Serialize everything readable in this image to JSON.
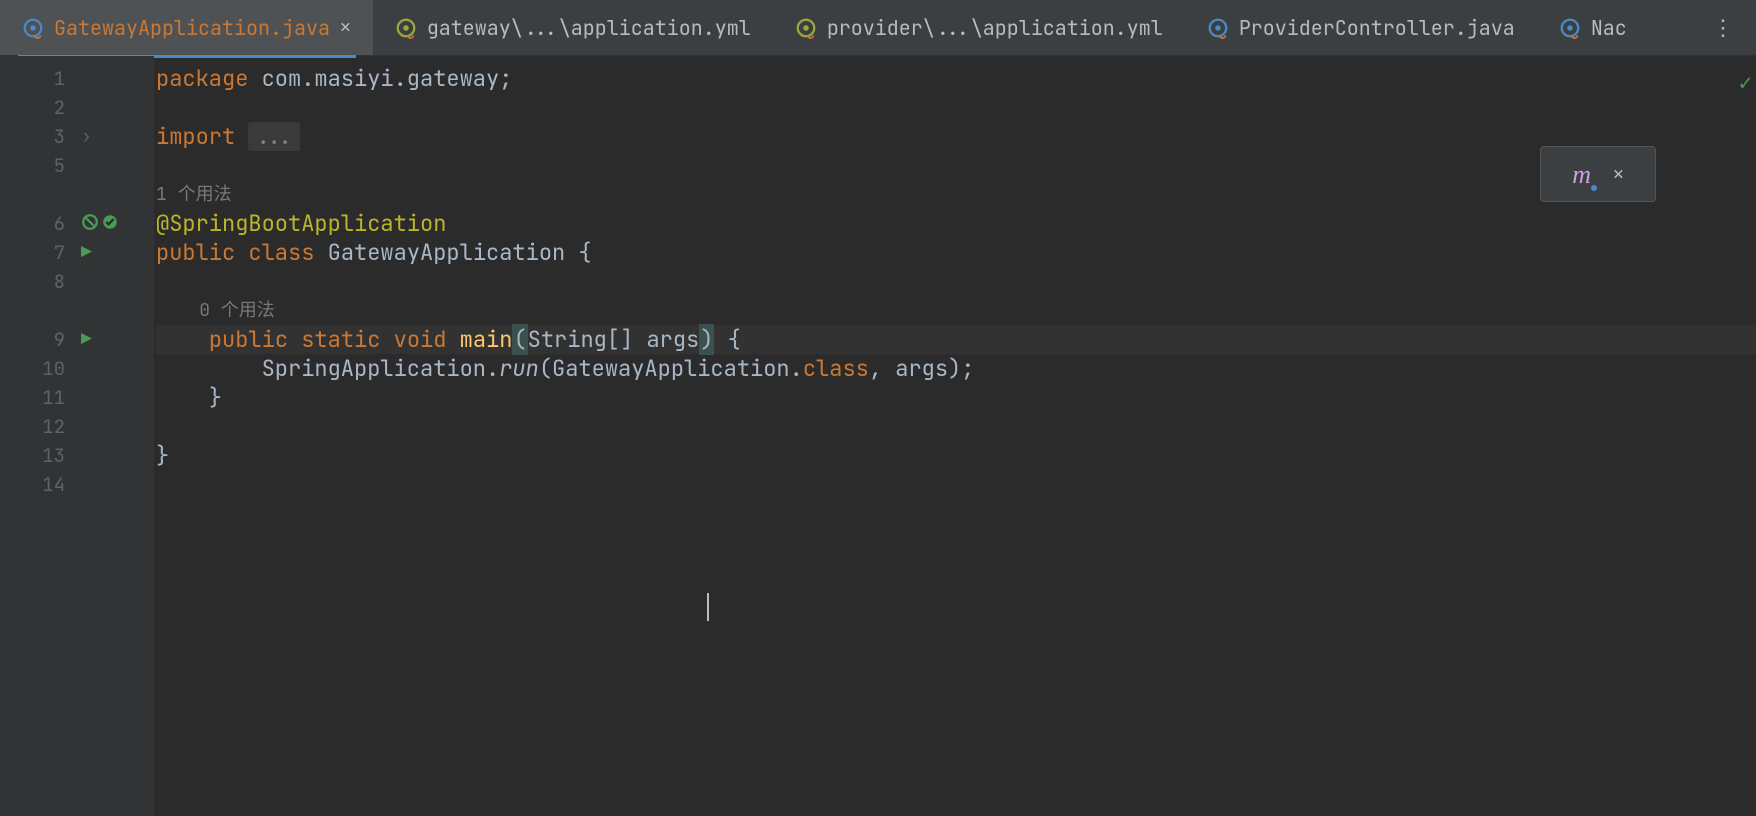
{
  "tabs": [
    {
      "label": "GatewayApplication.java",
      "active": true,
      "closeable": true,
      "iconColor": "#4a88c7"
    },
    {
      "label": "gateway\\...\\application.yml",
      "active": false,
      "closeable": false,
      "iconColor": "#9aa83a"
    },
    {
      "label": "provider\\...\\application.yml",
      "active": false,
      "closeable": false,
      "iconColor": "#9aa83a"
    },
    {
      "label": "ProviderController.java",
      "active": false,
      "closeable": false,
      "iconColor": "#4a88c7"
    },
    {
      "label": "Nac",
      "active": false,
      "closeable": false,
      "iconColor": "#4a88c7"
    }
  ],
  "lines": {
    "n1": "1",
    "n2": "2",
    "n3": "3",
    "n5": "5",
    "n6": "6",
    "n7": "7",
    "n8": "8",
    "n9": "9",
    "n10": "10",
    "n11": "11",
    "n12": "12",
    "n13": "13",
    "n14": "14"
  },
  "code": {
    "l1_kw": "package",
    "l1_rest": " com.masiyi.gateway;",
    "l3_kw": "import",
    "l3_fold": "...",
    "usage1": "1 个用法",
    "l6_ann": "@SpringBootApplication",
    "l7_kw1": "public",
    "l7_kw2": "class",
    "l7_cls": "GatewayApplication",
    "l7_brace": " {",
    "usage0": "0 个用法",
    "l9_kw1": "public",
    "l9_kw2": "static",
    "l9_kw3": "void",
    "l9_fn": "main",
    "l9_p1": "(",
    "l9_sig": "String[] args",
    "l9_p2": ")",
    "l9_brace": " {",
    "l10_a": "SpringApplication.",
    "l10_run": "run",
    "l10_b": "(GatewayApplication.",
    "l10_class": "class",
    "l10_c": ", args);",
    "l11": "}",
    "l13": "}"
  },
  "widget": {
    "icon": "m",
    "close": "✕"
  },
  "status": {
    "check": "✓"
  }
}
